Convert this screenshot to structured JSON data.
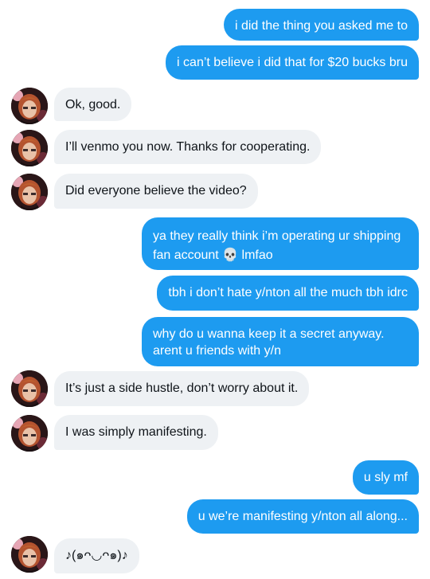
{
  "messages": [
    {
      "side": "out",
      "text": "i did the thing you asked me to"
    },
    {
      "side": "out",
      "text": "i can’t believe i did that for $20 bucks bru"
    },
    {
      "side": "in",
      "text": "Ok, good."
    },
    {
      "side": "in",
      "text": "I’ll venmo you now. Thanks for cooperating."
    },
    {
      "side": "in",
      "text": "Did everyone believe the video?"
    },
    {
      "side": "out",
      "text": "ya they really think i’m operating ur shipping fan account 💀 lmfao"
    },
    {
      "side": "out",
      "text": "tbh i don’t hate y/nton all the much tbh idrc"
    },
    {
      "side": "out",
      "text": "why do u wanna keep it a secret anyway. arent u friends with y/n"
    },
    {
      "side": "in",
      "text": "It’s just a side hustle, don’t worry about it."
    },
    {
      "side": "in",
      "text": "I was simply manifesting."
    },
    {
      "side": "out",
      "text": "u sly mf"
    },
    {
      "side": "out",
      "text": "u we’re manifesting y/nton all along..."
    },
    {
      "side": "in",
      "text": "♪(๑ᴖ◡ᴖ๑)♪"
    }
  ],
  "colors": {
    "outgoing_bubble": "#1d9bf0",
    "incoming_bubble": "#eef1f4",
    "outgoing_text": "#ffffff",
    "incoming_text": "#0f1419"
  },
  "avatar": {
    "icon": "user-avatar"
  }
}
